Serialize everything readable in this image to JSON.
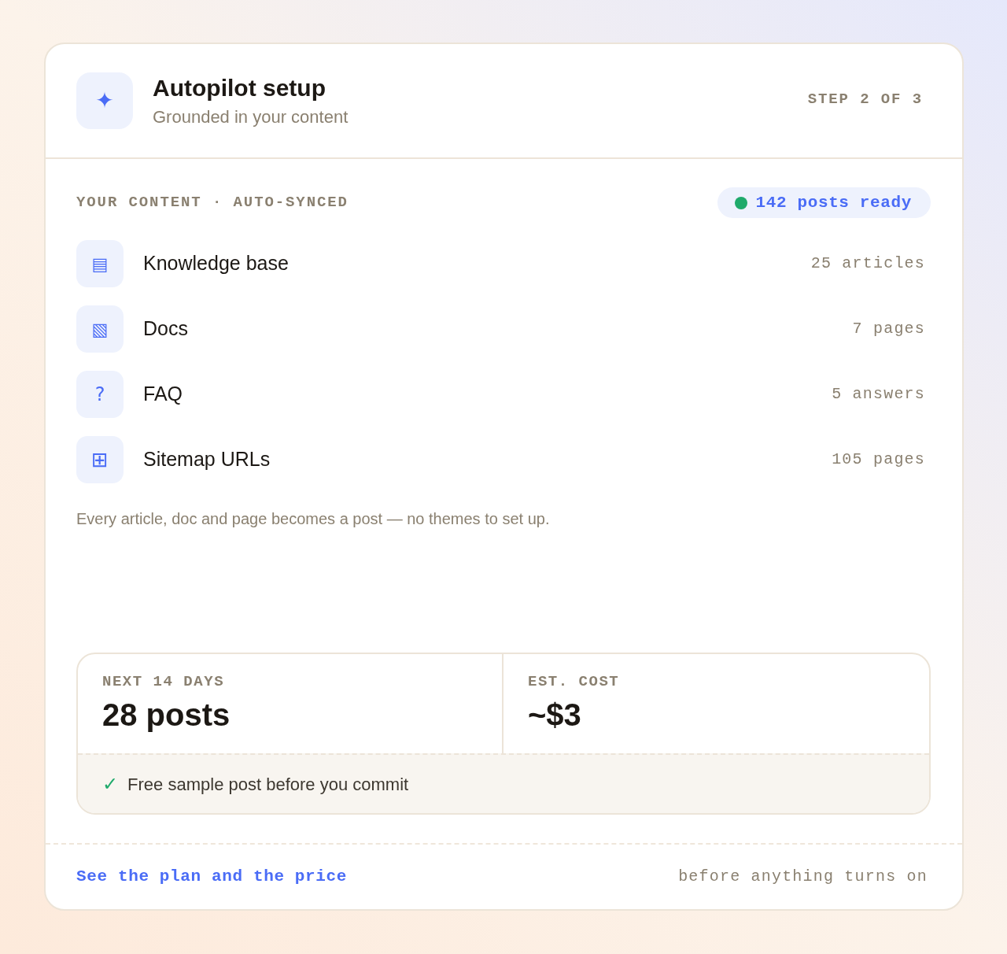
{
  "header": {
    "icon": "✦",
    "title": "Autopilot setup",
    "subtitle": "Grounded in your content",
    "step": "STEP 2 OF 3"
  },
  "content": {
    "heading": "YOUR CONTENT · AUTO-SYNCED",
    "badge": "142 posts ready",
    "sources": [
      {
        "kind": "lines",
        "icon": "▤",
        "name": "Knowledge base",
        "count": "25 articles"
      },
      {
        "kind": "hatched",
        "icon": "▧",
        "name": "Docs",
        "count": "7 pages"
      },
      {
        "kind": "question",
        "icon": "?",
        "name": "FAQ",
        "count": "5 answers"
      },
      {
        "kind": "grid",
        "icon": "⊞",
        "name": "Sitemap URLs",
        "count": "105 pages"
      }
    ],
    "note": "Every article, doc and page becomes a post — no themes to set up."
  },
  "summary": {
    "stats": [
      {
        "label": "NEXT 14 DAYS",
        "value": "28 posts"
      },
      {
        "label": "EST. COST",
        "value": "~$3"
      }
    ],
    "guarantee": {
      "icon": "✓",
      "text": "Free sample post before you commit"
    }
  },
  "footer": {
    "link": "See the plan and the price",
    "note": "before anything turns on"
  }
}
